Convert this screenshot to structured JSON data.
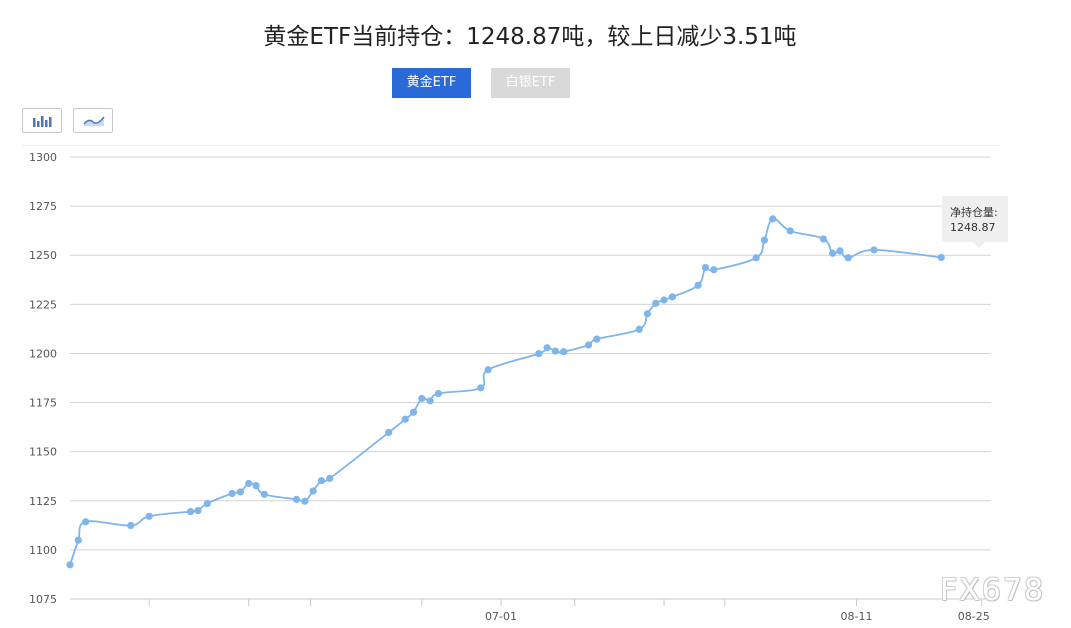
{
  "page_title": "黄金ETF当前持仓：1248.87吨，较上日减少3.51吨",
  "tabs": {
    "gold": "黄金ETF",
    "silver": "白银ETF"
  },
  "chart_type_buttons": [
    {
      "icon": "bar-chart-icon"
    },
    {
      "icon": "line-chart-icon"
    }
  ],
  "colors": {
    "active_tab": "#2a6ad8",
    "inactive_tab": "#d9d9d9",
    "series": "#7eb5ea",
    "grid": "#d4d4d4"
  },
  "tooltip": {
    "label": "净持仓量:",
    "value": "1248.87"
  },
  "watermark": "FX678",
  "chart_data": {
    "type": "line",
    "smooth": true,
    "x_tick_labels": [
      "07-01",
      "08-11",
      "08-25"
    ],
    "ylim": [
      1075,
      1300
    ],
    "y_ticks": [
      1075,
      1100,
      1125,
      1150,
      1175,
      1200,
      1225,
      1250,
      1275,
      1300
    ],
    "grid": "horizontal",
    "series": [
      {
        "values": [
          1092.4,
          1104.9,
          1114.3,
          1112.4,
          1117.1,
          1119.5,
          1120.0,
          1123.6,
          1128.7,
          1129.5,
          1133.8,
          1132.7,
          1128.3,
          1125.7,
          1124.8,
          1130.0,
          1135.3,
          1136.4,
          1159.8,
          1166.5,
          1170.1,
          1177.1,
          1175.9,
          1179.6,
          1182.5,
          1191.7,
          1199.9,
          1202.9,
          1201.2,
          1200.9,
          1204.3,
          1207.3,
          1212.3,
          1220.2,
          1225.5,
          1227.2,
          1228.8,
          1234.7,
          1243.7,
          1242.6,
          1248.7,
          1257.7,
          1268.5,
          1262.4,
          1258.3,
          1251.0,
          1252.2,
          1248.7,
          1252.7,
          1248.87
        ],
        "point_index_positions": [
          0.0,
          0.9,
          1.7,
          6.6,
          8.6,
          13.1,
          13.9,
          14.9,
          17.6,
          18.5,
          19.4,
          20.2,
          21.1,
          24.6,
          25.5,
          26.4,
          27.3,
          28.2,
          34.6,
          36.4,
          37.3,
          38.2,
          39.1,
          40.0,
          44.6,
          45.4,
          50.9,
          51.8,
          52.7,
          53.6,
          56.3,
          57.2,
          61.8,
          62.7,
          63.6,
          64.5,
          65.4,
          68.2,
          69.0,
          69.9,
          74.5,
          75.4,
          76.3,
          78.2,
          81.8,
          82.8,
          83.6,
          84.5,
          87.3,
          94.6
        ]
      }
    ],
    "x_ticks_at": [
      8.6,
      19.4,
      26.1,
      38.2,
      46.8,
      54.8,
      64.5,
      71.1,
      85.4,
      99.0
    ],
    "x_label_ticks": {
      "07-01": 46.8,
      "08-11": 85.4,
      "08-25": 99.0
    }
  }
}
